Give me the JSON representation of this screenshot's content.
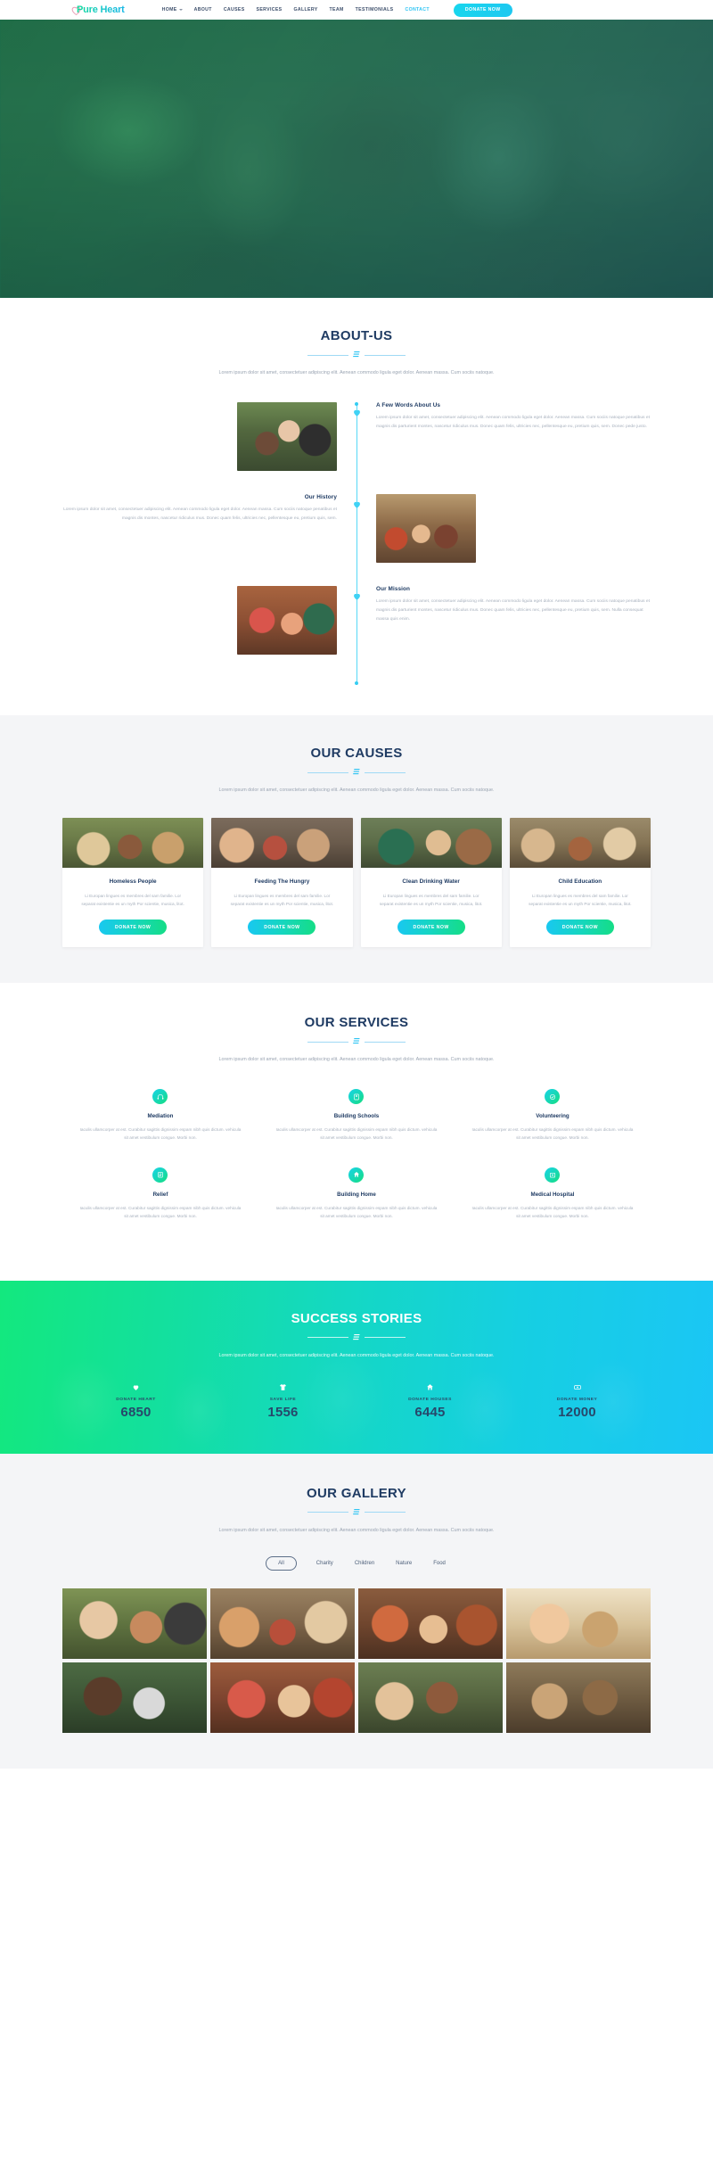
{
  "header": {
    "logo_text": "Pure Heart",
    "logo_icon": "heart-outline-icon",
    "nav": [
      {
        "label": "HOME",
        "has_caret": true,
        "active": false
      },
      {
        "label": "ABOUT",
        "has_caret": false,
        "active": false
      },
      {
        "label": "CAUSES",
        "has_caret": false,
        "active": false
      },
      {
        "label": "SERVICES",
        "has_caret": false,
        "active": false
      },
      {
        "label": "GALLERY",
        "has_caret": false,
        "active": false
      },
      {
        "label": "TEAM",
        "has_caret": false,
        "active": false
      },
      {
        "label": "TESTIMONIALS",
        "has_caret": false,
        "active": false
      },
      {
        "label": "CONTACT",
        "has_caret": false,
        "active": true
      }
    ],
    "donate_label": "DONATE NOW",
    "accent_color": "#2ec4f3"
  },
  "about": {
    "title": "ABOUT-US",
    "subtitle": "Lorem ipsum dolor sit amet, consectetuer adipiscing elit. Aenean commodo ligula eget dolor. Aenean massa. Cum sociis natoque.",
    "items": [
      {
        "heading": "A Few Words About Us",
        "text": "Lorem ipsum dolor sit amet, consectetuer adipiscing elit. Aenean commodo ligula eget dolor. Aenean massa. Cum sociis natoque penatibus et magnis dis parturient montes, nascetur ridiculus mus. Donec quam felis, ultricies nec, pellentesque eu, pretium quis, sem. Donec pede justo."
      },
      {
        "heading": "Our History",
        "text": "Lorem ipsum dolor sit amet, consectetuer adipiscing elit. Aenean commodo ligula eget dolor. Aenean massa. Cum sociis natoque penatibus et magnis dis montes, nascetur ridiculus mus. Donec quam felis, ultricies nec, pellentesque eu, pretium quis, sem."
      },
      {
        "heading": "Our Mission",
        "text": "Lorem ipsum dolor sit amet, consectetuer adipiscing elit. Aenean commodo ligula eget dolor. Aenean massa. Cum sociis natoque penatibus et magnis dis parturient montes, nascetur ridiculus mus. Donec quam felis, ultricies nec, pellentesque eu, pretium quis, sem. Nulla consequat massa quis enim."
      }
    ]
  },
  "causes": {
    "title": "OUR CAUSES",
    "subtitle": "Lorem ipsum dolor sit amet, consectetuer adipiscing elit. Aenean commodo ligula eget dolor. Aenean massa. Cum sociis natoque.",
    "cards": [
      {
        "title": "Homeless People",
        "text": "Li Europan lingues es membres del sam familie. Lor separat existentie es un myth Por scientie, musica, litot.",
        "button": "DONATE NOW"
      },
      {
        "title": "Feeding The Hungry",
        "text": "Li Europan lingues es membres del sam familie. Lor separat existentie es un myth Por scientie, musica, litot.",
        "button": "DONATE NOW"
      },
      {
        "title": "Clean Drinking Water",
        "text": "Li Europan lingues es membres del sam familie. Lor separat existentie es un myth Por scientie, musica, litot.",
        "button": "DONATE NOW"
      },
      {
        "title": "Child Education",
        "text": "Li Europan lingues es membres del sam familie. Lor separat existentie es un myth Por scientie, musica, litot.",
        "button": "DONATE NOW"
      }
    ]
  },
  "services": {
    "title": "OUR SERVICES",
    "subtitle": "Lorem ipsum dolor sit amet, consectetuer adipiscing elit. Aenean commodo ligula eget dolor. Aenean massa. Cum sociis natoque.",
    "items": [
      {
        "title": "Mediation",
        "icon": "headphones-icon",
        "text": "Iaculis ullamcorper at est. Curabitur sagittis dignissim espam nibh quis dictum. vehicula sit amet vestibulum congue. Morbi non."
      },
      {
        "title": "Building Schools",
        "icon": "book-icon",
        "text": "Iaculis ullamcorper at est. Curabitur sagittis dignissim espam nibh quis dictum. vehicula sit amet vestibulum congue. Morbi non."
      },
      {
        "title": "Volunteering",
        "icon": "handshake-icon",
        "text": "Iaculis ullamcorper at est. Curabitur sagittis dignissim espam nibh quis dictum. vehicula sit amet vestibulum congue. Morbi non."
      },
      {
        "title": "Relief",
        "icon": "clipboard-icon",
        "text": "Iaculis ullamcorper at est. Curabitur sagittis dignissim espam nibh quis dictum. vehicula sit amet vestibulum congue. Morbi non."
      },
      {
        "title": "Building Home",
        "icon": "home-icon",
        "text": "Iaculis ullamcorper at est. Curabitur sagittis dignissim espam nibh quis dictum. vehicula sit amet vestibulum congue. Morbi non."
      },
      {
        "title": "Medical Hospital",
        "icon": "hospital-icon",
        "text": "Iaculis ullamcorper at est. Curabitur sagittis dignissim espam nibh quis dictum. vehicula sit amet vestibulum congue. Morbi non."
      }
    ]
  },
  "success": {
    "title": "SUCCESS STORIES",
    "subtitle": "Lorem ipsum dolor sit amet, consectetuer adipiscing elit. Aenean commodo ligula eget dolor. Aenean massa. Cum sociis natoque.",
    "counters": [
      {
        "label": "DONATE HEART",
        "value": "6850",
        "icon": "heart-icon"
      },
      {
        "label": "SAVE LIFE",
        "value": "1556",
        "icon": "shirt-icon"
      },
      {
        "label": "DONATE HOUSES",
        "value": "6445",
        "icon": "home-icon"
      },
      {
        "label": "DONATE MONEY",
        "value": "12000",
        "icon": "money-icon"
      }
    ]
  },
  "gallery": {
    "title": "OUR GALLERY",
    "subtitle": "Lorem ipsum dolor sit amet, consectetuer adipiscing elit. Aenean commodo ligula eget dolor. Aenean massa. Cum sociis natoque.",
    "filters": [
      {
        "label": "All",
        "active": true
      },
      {
        "label": "Charity",
        "active": false
      },
      {
        "label": "Children",
        "active": false
      },
      {
        "label": "Nature",
        "active": false
      },
      {
        "label": "Food",
        "active": false
      }
    ],
    "item_count": 8
  }
}
